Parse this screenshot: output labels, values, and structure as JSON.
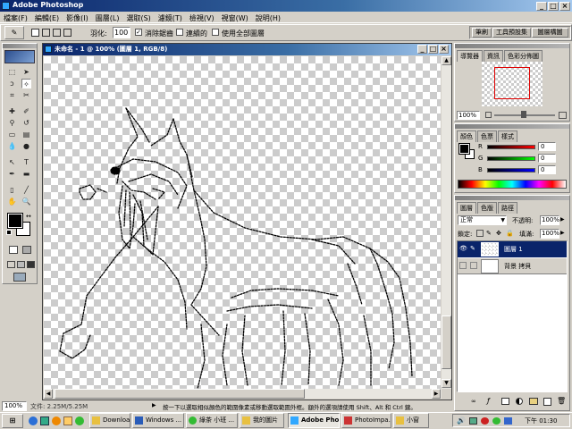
{
  "app": {
    "title": "Adobe Photoshop"
  },
  "menu": [
    "檔案(F)",
    "編輯(E)",
    "影像(I)",
    "圖層(L)",
    "選取(S)",
    "濾鏡(T)",
    "檢視(V)",
    "視窗(W)",
    "說明(H)"
  ],
  "options": {
    "feather_label": "羽化:",
    "feather_value": "100",
    "antialias_label": "消除鋸齒",
    "contiguous_label": "連續的",
    "all_layers_label": "使用全部圖層"
  },
  "palette_well": [
    "筆刷",
    "工具預設集",
    "圖層構圖"
  ],
  "document": {
    "title": "未命名 - 1 @ 100% (圖層 1, RGB/8)"
  },
  "navigator": {
    "tabs": [
      "導覽器",
      "資訊",
      "色彩分佈圖"
    ],
    "zoom": "100%"
  },
  "color_panel": {
    "tabs": [
      "顏色",
      "色票",
      "樣式"
    ],
    "channels": [
      {
        "label": "R",
        "value": "0",
        "color": "#c00000"
      },
      {
        "label": "G",
        "value": "0",
        "color": "#00a000"
      },
      {
        "label": "B",
        "value": "0",
        "color": "#0000c0"
      }
    ]
  },
  "layers_panel": {
    "tabs": [
      "圖層",
      "色版",
      "路徑"
    ],
    "blend_mode": "正常",
    "opacity_label": "不透明:",
    "opacity_value": "100%",
    "lock_label": "鎖定:",
    "fill_label": "填滿:",
    "fill_value": "100%",
    "layers": [
      {
        "name": "圖層 1",
        "selected": true
      },
      {
        "name": "背景 拷貝",
        "selected": false
      }
    ]
  },
  "status": {
    "zoom": "100%",
    "doc_info": "文件: 2.25M/5.25M",
    "hint": "按一下以選取相似顏色的範圍像素或移動選取範圍外框。額外的選項請使用 Shift、Alt 和 Ctrl 鍵。"
  },
  "taskbar": {
    "items": [
      "Download",
      "Windows ...",
      "綠茶 小班 ...",
      "我的圖片",
      "Adobe Pho...",
      "PhotoImpa...",
      "小窗"
    ],
    "time": "下午 01:30"
  }
}
